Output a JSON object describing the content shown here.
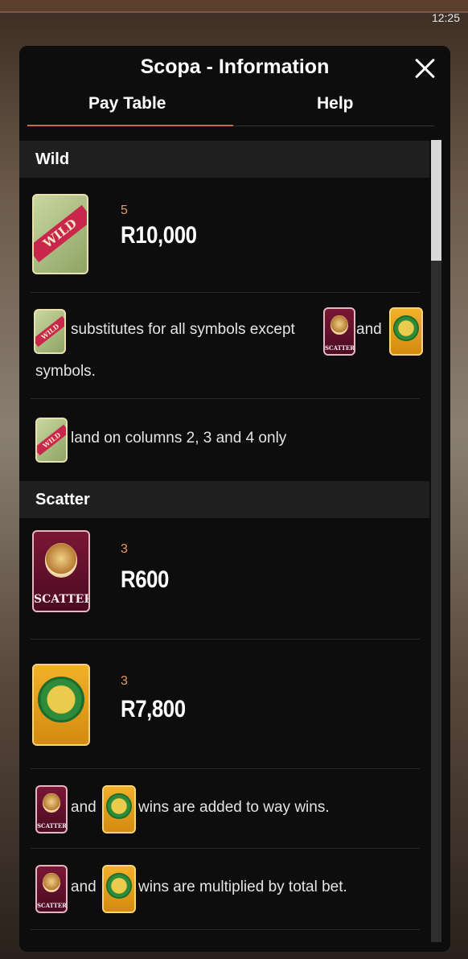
{
  "status_bar": {
    "time": "12:25"
  },
  "panel": {
    "title": "Scopa - Information"
  },
  "tabs": [
    {
      "label": "Pay Table",
      "active": true
    },
    {
      "label": "Help",
      "active": false
    }
  ],
  "sections": {
    "wild": {
      "header": "Wild",
      "pay": {
        "count": "5",
        "amount": "R10,000"
      },
      "rule1": {
        "text_a": "substitutes for all symbols except",
        "text_b": "and",
        "text_c": "symbols."
      },
      "rule2": {
        "text": "land on columns 2, 3 and 4 only"
      }
    },
    "scatter": {
      "header": "Scatter",
      "pay1": {
        "count": "3",
        "amount": "R600"
      },
      "pay2": {
        "count": "3",
        "amount": "R7,800"
      },
      "rule1": {
        "text_a": "and",
        "text_b": "wins are added to way wins."
      },
      "rule2": {
        "text_a": "and",
        "text_b": "wins are multiplied by total bet."
      }
    }
  },
  "symbols": {
    "wild_label": "WILD",
    "scatter_label": "SCATTER"
  },
  "colors": {
    "accent": "#c96a4e",
    "pay_count": "#e39a68",
    "panel_bg": "#0d0d0d",
    "section_header_bg": "#1f1f1f"
  }
}
